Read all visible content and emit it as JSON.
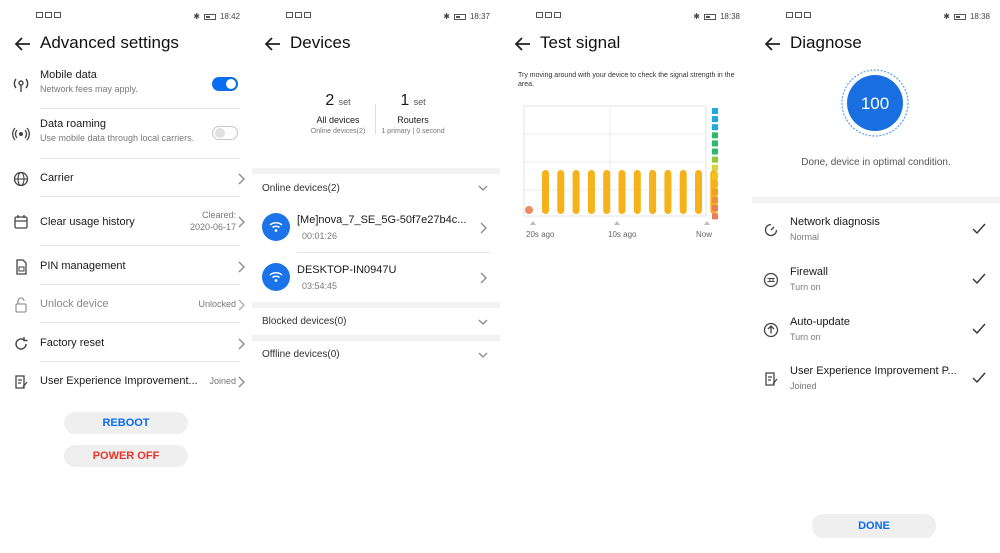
{
  "screens": [
    {
      "status_time": "18:42",
      "title": "Advanced settings",
      "items": [
        {
          "label": "Mobile data",
          "sub": "Network fees may apply.",
          "icon": "antenna-icon",
          "toggle": true
        },
        {
          "label": "Data roaming",
          "sub": "Use mobile data through local carriers.",
          "icon": "roaming-icon",
          "toggle": false
        },
        {
          "label": "Carrier",
          "icon": "globe-icon"
        },
        {
          "label": "Clear usage history",
          "icon": "calendar-icon",
          "value_line1": "Cleared:",
          "value_line2": "2020-06-17"
        },
        {
          "label": "PIN management",
          "icon": "sim-card-icon"
        },
        {
          "label": "Unlock device",
          "icon": "unlock-icon",
          "value": "Unlocked",
          "disabled": true
        },
        {
          "label": "Factory reset",
          "icon": "reset-icon"
        },
        {
          "label": "User Experience Improvement...",
          "icon": "document-edit-icon",
          "value": "Joined"
        }
      ],
      "reboot_label": "REBOOT",
      "power_off_label": "POWER OFF",
      "colors": {
        "accent": "#0a6cf0",
        "danger": "#e8352a"
      }
    },
    {
      "status_time": "18:37",
      "title": "Devices",
      "summary": [
        {
          "count": "2",
          "unit": "set",
          "label": "All devices",
          "sub": "Online devices(2)"
        },
        {
          "count": "1",
          "unit": "set",
          "label": "Routers",
          "sub": "1 primary | 0 second"
        }
      ],
      "online_header": "Online devices(2)",
      "devices": [
        {
          "name": "[Me]nova_7_SE_5G-50f7e27b4c...",
          "time": "00:01:26"
        },
        {
          "name": "DESKTOP-IN0947U",
          "time": "03:54:45"
        }
      ],
      "blocked_header": "Blocked devices(0)",
      "offline_header": "Offline devices(0)"
    },
    {
      "status_time": "18:38",
      "title": "Test signal",
      "instructions": "Try moving around with your device to check the signal strength in the area.",
      "x_labels": [
        "20s ago",
        "10s ago",
        "Now"
      ]
    },
    {
      "status_time": "18:38",
      "title": "Diagnose",
      "score": "100",
      "result_text": "Done, device in optimal condition.",
      "items": [
        {
          "label": "Network diagnosis",
          "sub": "Normal",
          "icon": "gauge-icon"
        },
        {
          "label": "Firewall",
          "sub": "Turn on",
          "icon": "firewall-icon"
        },
        {
          "label": "Auto-update",
          "sub": "Turn on",
          "icon": "upload-icon"
        },
        {
          "label": "User Experience Improvement P...",
          "sub": "Joined",
          "icon": "document-edit-icon"
        }
      ],
      "done_label": "DONE"
    }
  ]
}
